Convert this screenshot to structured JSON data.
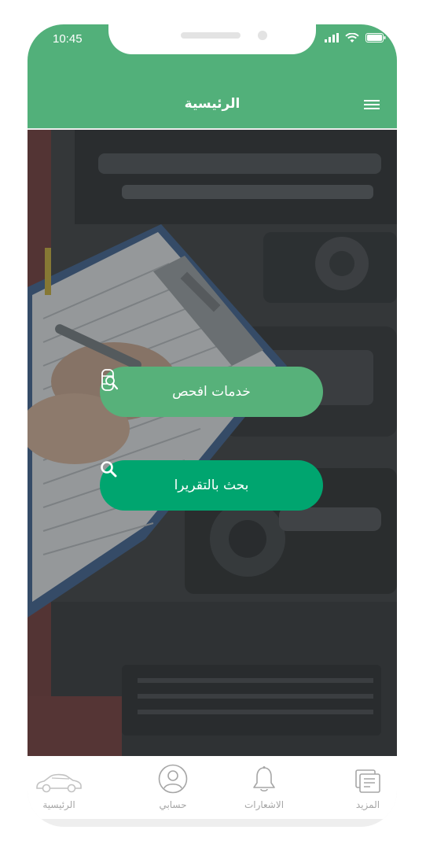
{
  "status_bar": {
    "time": "10:45"
  },
  "header": {
    "title": "الرئيسية"
  },
  "actions": {
    "services_label": "خدمات افحص",
    "search_label": "بحث بالتقريرا"
  },
  "bottom_nav": {
    "items": [
      {
        "label": "الرئيسية",
        "icon": "car-icon"
      },
      {
        "label": "حسابي",
        "icon": "user-icon"
      },
      {
        "label": "الاشعارات",
        "icon": "bell-icon"
      },
      {
        "label": "المزيد",
        "icon": "more-icon"
      }
    ]
  },
  "colors": {
    "primary_green": "#52b07a",
    "button_green": "#57b17a",
    "button_dark_green": "#00a56f",
    "nav_inactive": "#a6a6a6"
  }
}
